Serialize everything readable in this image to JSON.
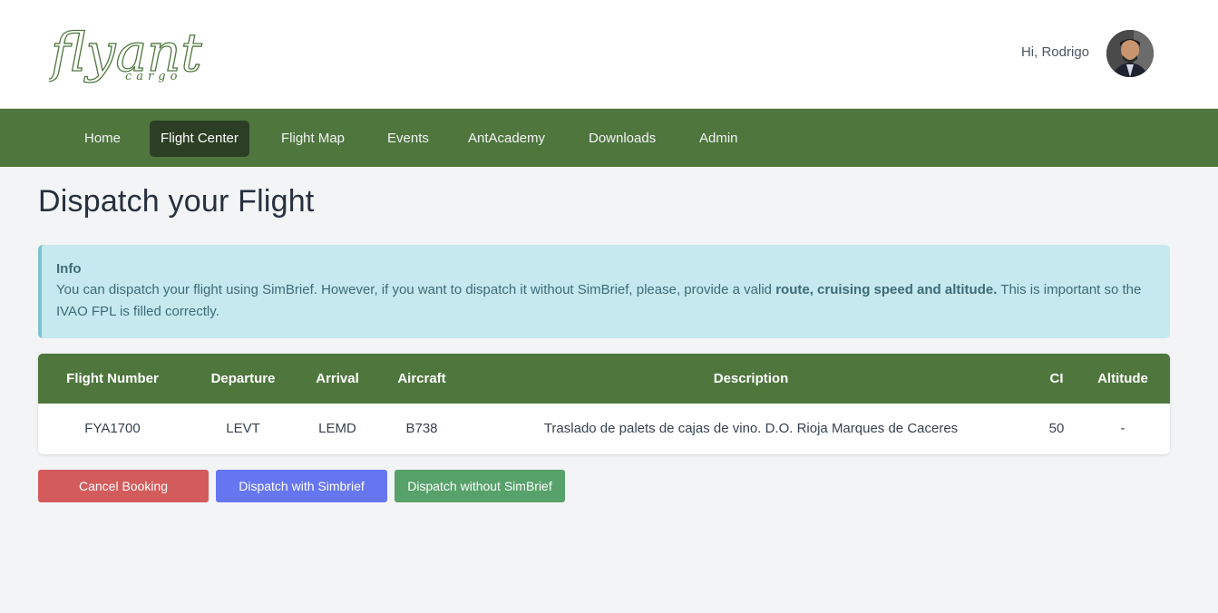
{
  "brand": {
    "logo_main": "flyant",
    "logo_sub": "cargo"
  },
  "user": {
    "greeting": "Hi, Rodrigo"
  },
  "nav": {
    "items": [
      {
        "label": "Home"
      },
      {
        "label": "Flight Center"
      },
      {
        "label": "Flight Map"
      },
      {
        "label": "Events"
      },
      {
        "label": "AntAcademy"
      },
      {
        "label": "Downloads"
      },
      {
        "label": "Admin"
      }
    ],
    "active": "Flight Center"
  },
  "page": {
    "title": "Dispatch your Flight"
  },
  "info": {
    "title": "Info",
    "text_before": "You can dispatch your flight using SimBrief. However, if you want to dispatch it without SimBrief, please, provide a valid ",
    "text_bold": "route, cruising speed and altitude.",
    "text_after": " This is important so the IVAO FPL is filled correctly."
  },
  "table": {
    "headers": [
      "Flight Number",
      "Departure",
      "Arrival",
      "Aircraft",
      "Description",
      "CI",
      "Altitude"
    ],
    "rows": [
      [
        "FYA1700",
        "LEVT",
        "LEMD",
        "B738",
        "Traslado de palets de cajas de vino. D.O. Rioja Marques de Caceres",
        "50",
        "-"
      ]
    ]
  },
  "actions": {
    "cancel": "Cancel Booking",
    "simbrief": "Dispatch with Simbrief",
    "no_simbrief": "Dispatch without SimBrief"
  },
  "colors": {
    "nav_green": "#4e763d",
    "nav_active": "#2c3f25",
    "info_bg": "#c5e9ee",
    "cancel_red": "#d35b5b",
    "simbrief_blue": "#6676f1",
    "nosimbrief_green": "#57a16b"
  }
}
